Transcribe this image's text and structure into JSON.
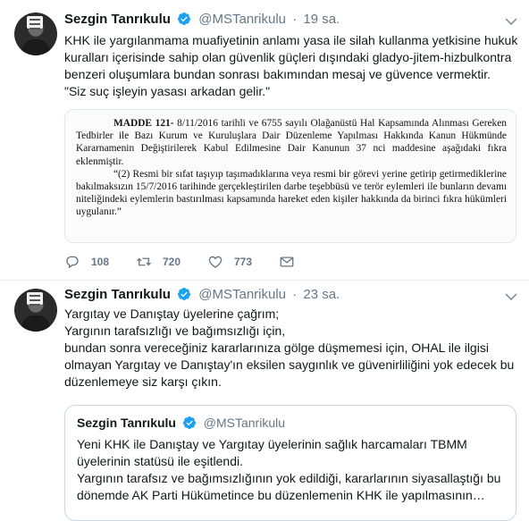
{
  "colors": {
    "accent": "#1da1f2",
    "secondary_text": "#657786",
    "border": "#e6ecf0"
  },
  "tweets": [
    {
      "author_name": "Sezgin Tanrıkulu",
      "handle": "@MSTanrikulu",
      "separator": "·",
      "time": "19 sa.",
      "text_lines": [
        "KHK ile yargılanmama muafiyetinin anlamı yasa ile silah kullanma yetkisine hukuk",
        "kuralları içerisinde sahip olan güvenlik güçleri dışındaki gladyo-jitem-hizbulkontra",
        "benzeri oluşumlara bundan sonrası bakımından mesaj ve güvence vermektir.",
        "\"Siz suç işleyin yasası arkadan gelir.\""
      ],
      "document": {
        "heading": "MADDE 121-",
        "para1": " 8/11/2016 tarihli ve 6755 sayılı Olağanüstü Hal Kapsamında Alınması Gereken Tedbirler ile Bazı Kurum ve Kuruluşlara Dair Düzenleme Yapılması Hakkında Kanun Hükmünde Kararnamenin Değiştirilerek Kabul Edilmesine Dair Kanunun 37 nci maddesine aşağıdaki fıkra eklenmiştir.",
        "para2": "“(2) Resmi bir sıfat taşıyıp taşımadıklarına veya resmi bir görevi yerine getirip getirmediklerine bakılmaksızın 15/7/2016 tarihinde gerçekleştirilen darbe teşebbüsü ve terör eylemleri ile bunların devamı niteliğindeki eylemlerin bastırılması kapsamında hareket eden kişiler hakkında da birinci fıkra hükümleri uygulanır.”"
      },
      "actions": {
        "replies": "108",
        "retweets": "720",
        "likes": "773"
      }
    },
    {
      "author_name": "Sezgin Tanrıkulu",
      "handle": "@MSTanrikulu",
      "separator": "·",
      "time": "23 sa.",
      "text_lines": [
        "Yargıtay ve Danıştay üyelerine çağrım;",
        "Yargının tarafsızlığı ve bağımsızlığı için,",
        "bundan sonra vereceğiniz kararlarınıza gölge düşmemesi için, OHAL ile ilgisi",
        "olmayan Yargıtay ve Danıştay'ın eksilen saygınlık ve güvenirliliğini yok edecek bu",
        "düzenlemeye siz karşı çıkın."
      ],
      "quote": {
        "author_name": "Sezgin Tanrıkulu",
        "handle": "@MSTanrikulu",
        "text_lines": [
          "Yeni KHK ile Danıştay ve Yargıtay üyelerinin sağlık harcamaları TBMM",
          "üyelerinin statüsü ile eşitlendi.",
          "Yargının tarafsız ve bağımsızlığının yok edildiği, kararlarının siyasallaştığı bu",
          "dönemde AK Parti Hükümetince bu düzenlemenin KHK ile yapılmasının…"
        ]
      }
    }
  ]
}
